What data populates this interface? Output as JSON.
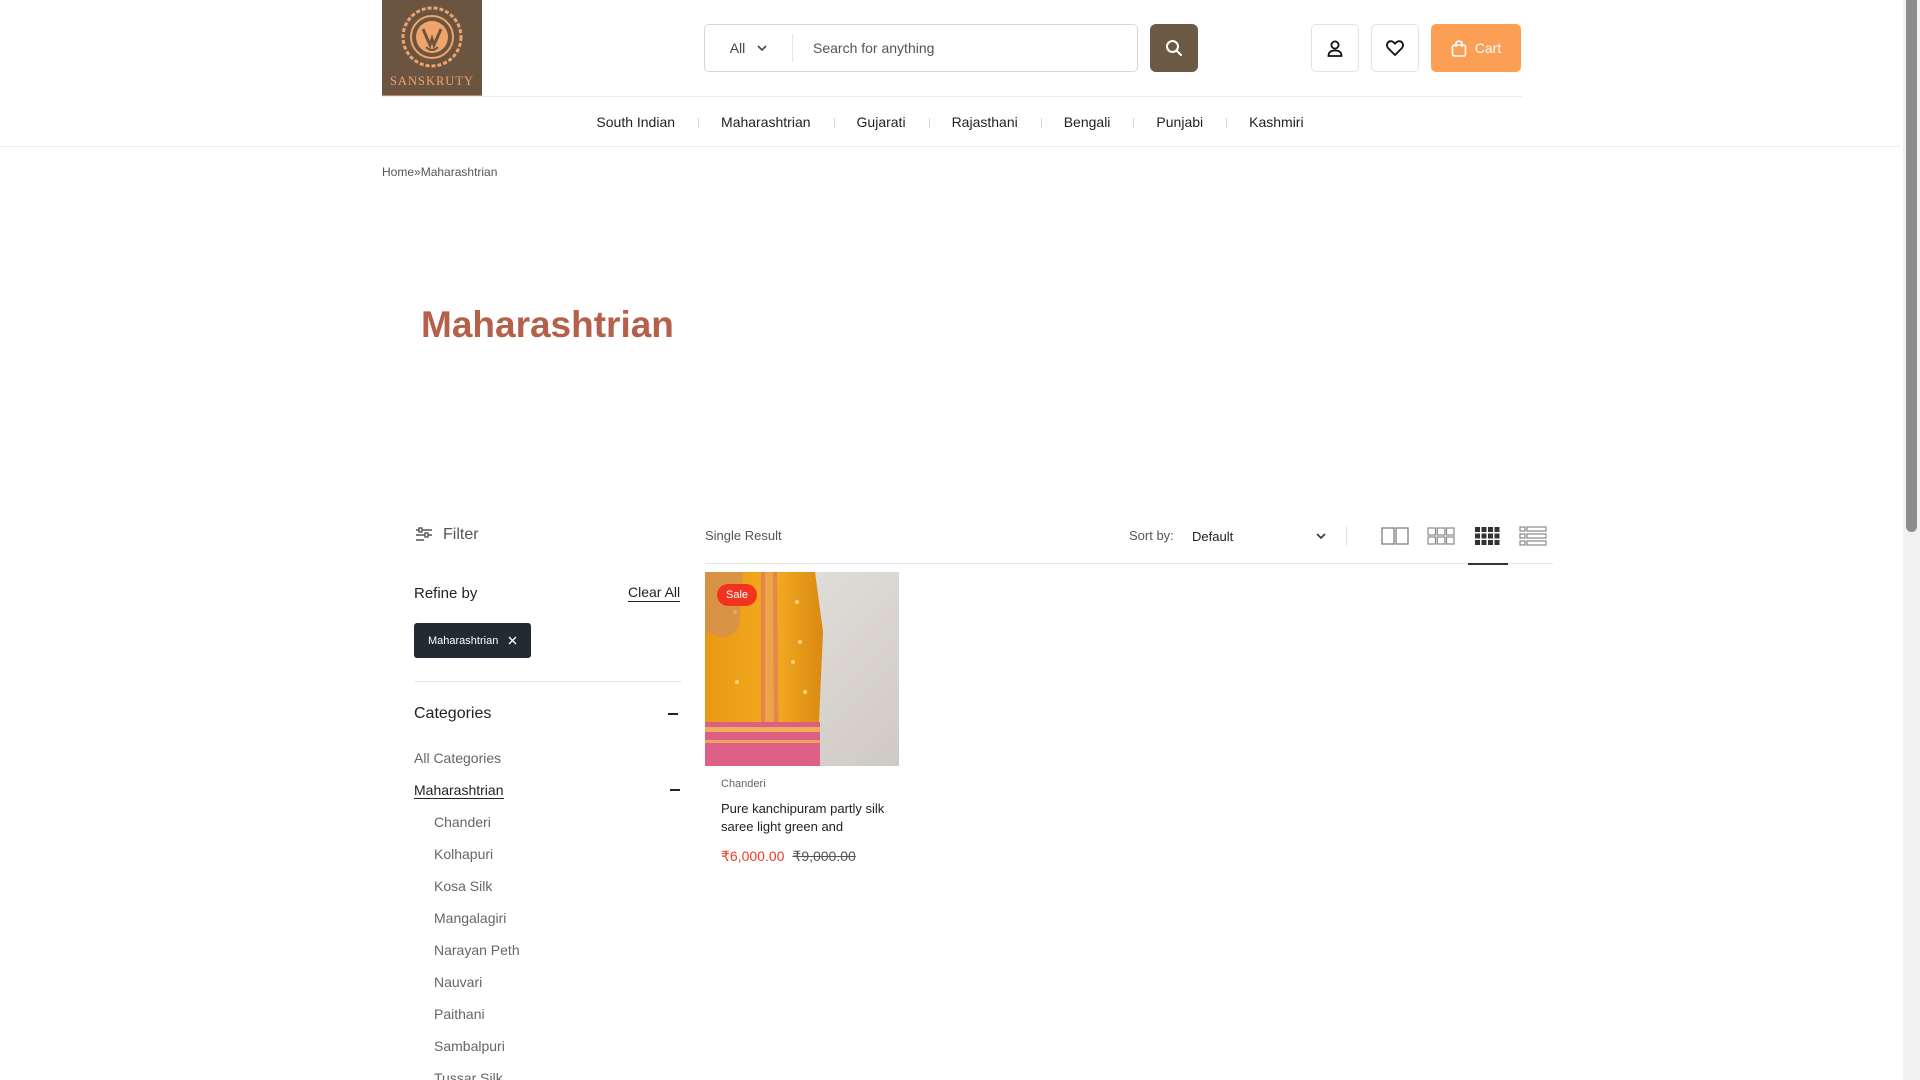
{
  "brand": {
    "name": "SANSKRUTY",
    "logo_color": "#6b5541",
    "accent_color": "#fb9f55",
    "title_color": "#b5604a"
  },
  "search": {
    "category": "All",
    "placeholder": "Search for anything",
    "icon": "search-icon"
  },
  "header": {
    "account_icon": "user-icon",
    "wishlist_icon": "heart-icon",
    "cart_label": "Cart",
    "cart_icon": "shopping-bag-icon"
  },
  "nav": {
    "items": [
      "South Indian",
      "Maharashtrian",
      "Gujarati",
      "Rajasthani",
      "Bengali",
      "Punjabi",
      "Kashmiri"
    ]
  },
  "breadcrumb": {
    "home": "Home",
    "separator": "»",
    "current": "Maharashtrian"
  },
  "page": {
    "title": "Maharashtrian"
  },
  "sidebar": {
    "filter_label": "Filter",
    "refine_title": "Refine by",
    "clear_all": "Clear All",
    "active_filter": "Maharashtrian",
    "categories_title": "Categories",
    "categories": [
      {
        "label": "All Categories",
        "level": 0
      },
      {
        "label": "Maharashtrian",
        "level": 0,
        "active": true
      },
      {
        "label": "Chanderi",
        "level": 1
      },
      {
        "label": "Kolhapuri",
        "level": 1
      },
      {
        "label": "Kosa Silk",
        "level": 1
      },
      {
        "label": "Mangalagiri",
        "level": 1
      },
      {
        "label": "Narayan Peth",
        "level": 1
      },
      {
        "label": "Nauvari",
        "level": 1
      },
      {
        "label": "Paithani",
        "level": 1
      },
      {
        "label": "Sambalpuri",
        "level": 1
      },
      {
        "label": "Tussar Silk",
        "level": 1
      }
    ]
  },
  "toolbar": {
    "results": "Single Result",
    "sort_label": "Sort by:",
    "sort_value": "Default",
    "views": [
      "grid-2-icon",
      "grid-3-icon",
      "grid-4-icon",
      "list-icon"
    ],
    "active_view": "grid-4-icon"
  },
  "products": [
    {
      "badge": "Sale",
      "category": "Chanderi",
      "name": "Pure kanchipuram partly silk saree light green and",
      "price_sale": "₹6,000.00",
      "price_regular": "₹9,000.00"
    }
  ]
}
